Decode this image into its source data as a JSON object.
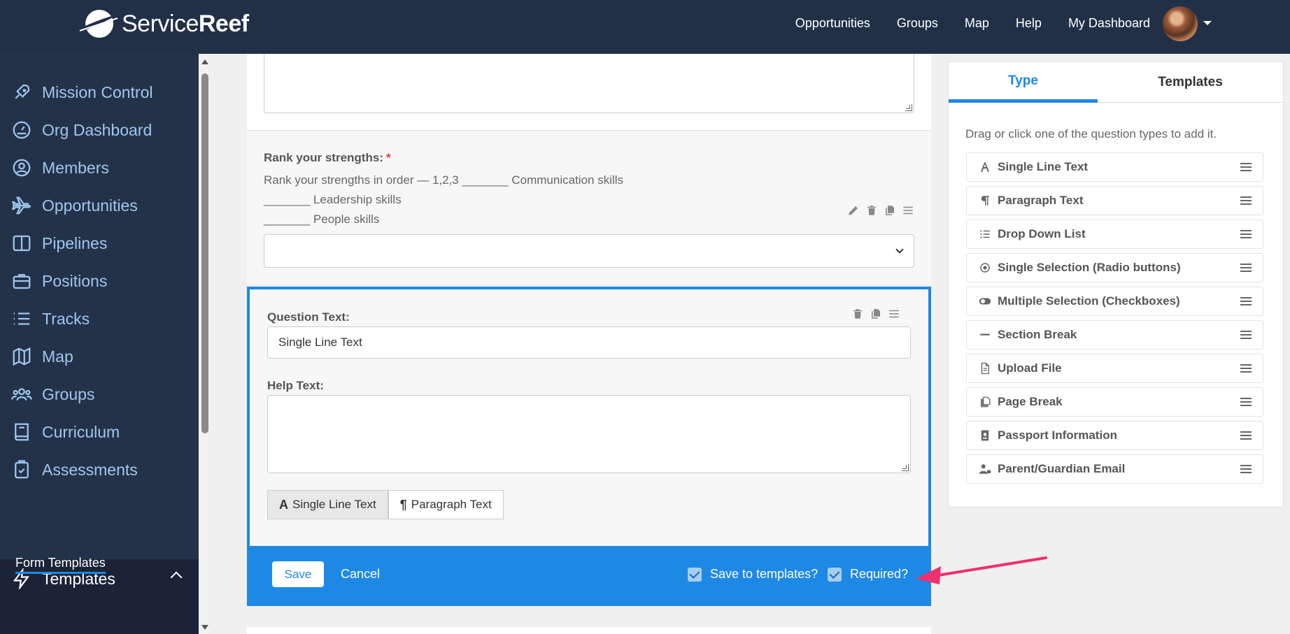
{
  "brand": {
    "name_light": "Service",
    "name_bold": "Reef"
  },
  "topnav": [
    "Opportunities",
    "Groups",
    "Map",
    "Help",
    "My Dashboard"
  ],
  "sidebar": {
    "items": [
      {
        "label": "Mission Control",
        "icon": "rocket-icon"
      },
      {
        "label": "Org Dashboard",
        "icon": "gauge-icon"
      },
      {
        "label": "Members",
        "icon": "user-circle-icon"
      },
      {
        "label": "Opportunities",
        "icon": "plane-icon"
      },
      {
        "label": "Pipelines",
        "icon": "columns-icon"
      },
      {
        "label": "Positions",
        "icon": "briefcase-icon"
      },
      {
        "label": "Tracks",
        "icon": "list-icon"
      },
      {
        "label": "Map",
        "icon": "map-icon"
      },
      {
        "label": "Groups",
        "icon": "users-icon"
      },
      {
        "label": "Curriculum",
        "icon": "book-icon"
      },
      {
        "label": "Assessments",
        "icon": "clipboard-check-icon"
      }
    ],
    "active": {
      "label": "Templates",
      "icon": "bolt-icon"
    },
    "sub_item": "Form Templates"
  },
  "rank_question": {
    "label": "Rank your strengths:",
    "required_mark": "*",
    "lines": [
      "Rank your strengths in order — 1,2,3 _______ Communication skills",
      "_______ Leadership skills",
      "_______ People skills"
    ]
  },
  "editor": {
    "question_label": "Question Text:",
    "question_value": "Single Line Text",
    "help_label": "Help Text:",
    "type_buttons": [
      {
        "glyph": "A",
        "label": "Single Line Text"
      },
      {
        "glyph": "¶",
        "label": "Paragraph Text"
      }
    ],
    "save_label": "Save",
    "cancel_label": "Cancel",
    "save_templates_label": "Save to templates?",
    "required_label": "Required?"
  },
  "panel": {
    "tabs": [
      "Type",
      "Templates"
    ],
    "hint": "Drag or click one of the question types to add it.",
    "question_types": [
      {
        "label": "Single Line Text",
        "icon": "letter-a-icon"
      },
      {
        "label": "Paragraph Text",
        "icon": "pilcrow-icon"
      },
      {
        "label": "Drop Down List",
        "icon": "list-icon"
      },
      {
        "label": "Single Selection (Radio buttons)",
        "icon": "radio-icon"
      },
      {
        "label": "Multiple Selection (Checkboxes)",
        "icon": "toggle-icon"
      },
      {
        "label": "Section Break",
        "icon": "minus-icon"
      },
      {
        "label": "Upload File",
        "icon": "file-icon"
      },
      {
        "label": "Page Break",
        "icon": "copy-icon"
      },
      {
        "label": "Passport Information",
        "icon": "passport-icon"
      },
      {
        "label": "Parent/Guardian Email",
        "icon": "user-lock-icon"
      }
    ]
  },
  "colors": {
    "navbar": "#223047",
    "sidebar": "#243249",
    "accent": "#1e88e5",
    "annotation_arrow": "#f0306e"
  }
}
